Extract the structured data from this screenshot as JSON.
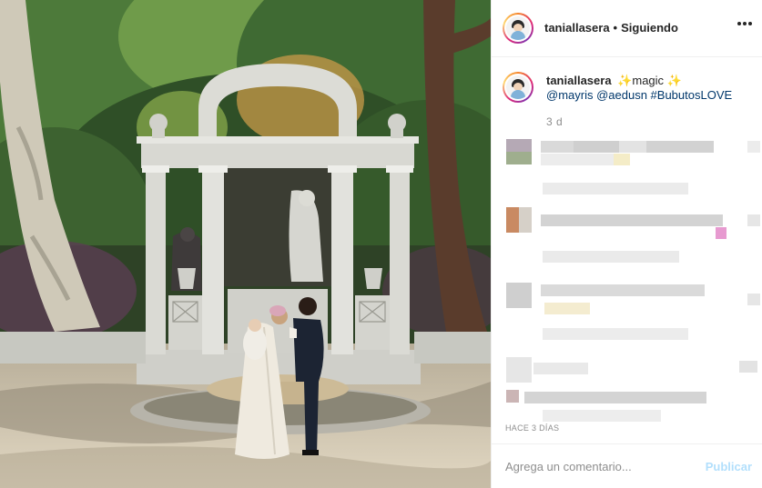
{
  "post": {
    "image_alt": "Wedding couple kissing holding a baby in front of a stone arch monument in a park"
  },
  "header": {
    "username": "taniallasera",
    "separator": "•",
    "follow_status": "Siguiendo",
    "more_icon": "more-horizontal-icon"
  },
  "caption": {
    "username": "taniallasera",
    "sparkle_left": "✨",
    "text": "magic",
    "sparkle_right": "✨",
    "mentions": "@mayris @aedusn #BubutosLOVE",
    "time": "3 d"
  },
  "footer": {
    "timestamp": "HACE 3 DÍAS",
    "comment_placeholder": "Agrega un comentario...",
    "publish_label": "Publicar"
  },
  "colors": {
    "accent_disabled": "#b2dffc",
    "mention": "#00376b",
    "muted": "#8e8e8e"
  }
}
